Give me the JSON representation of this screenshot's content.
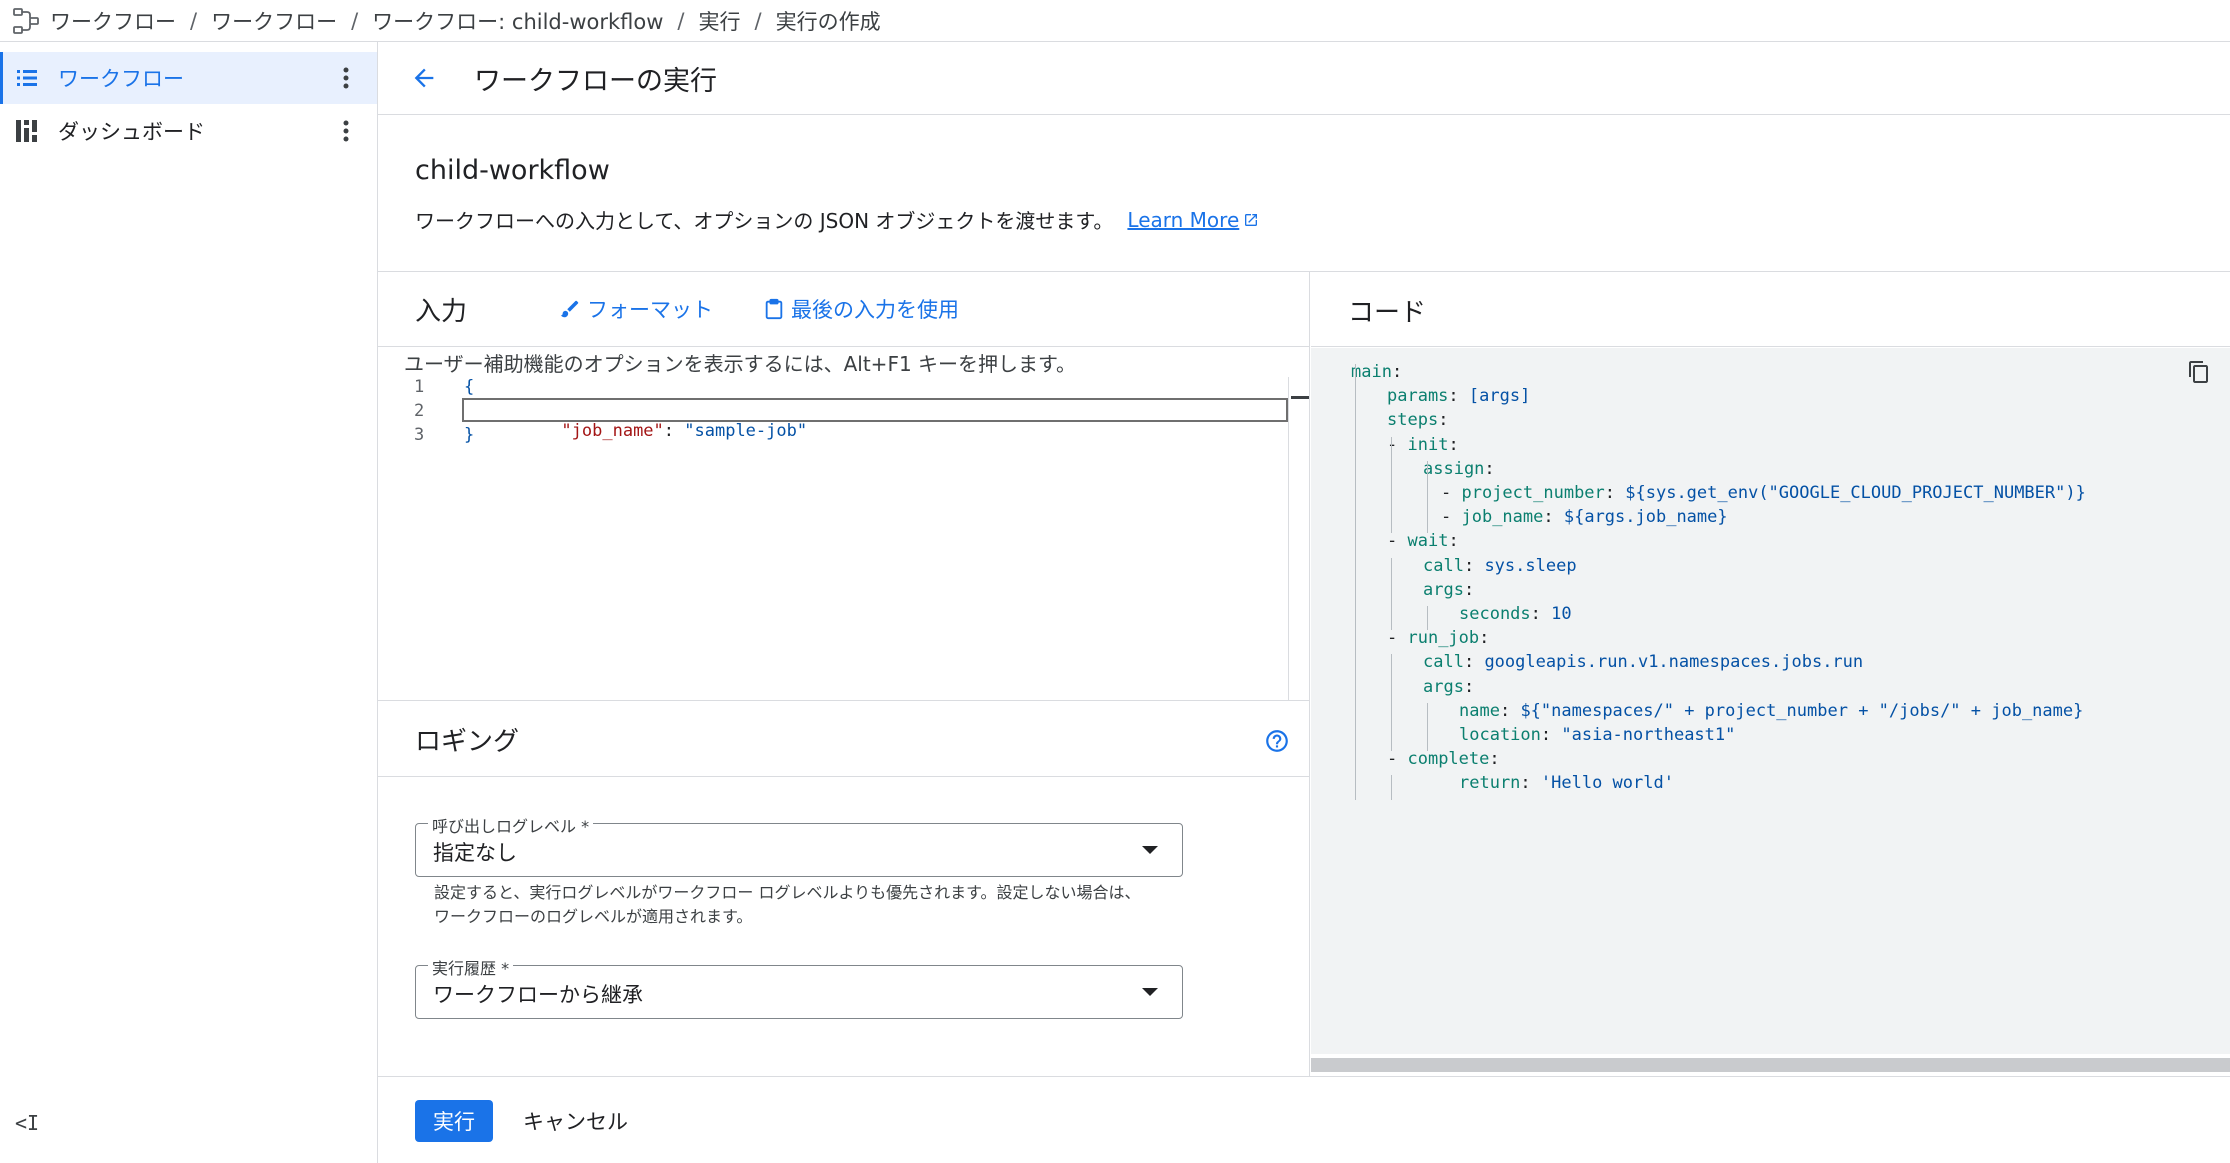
{
  "breadcrumb": {
    "items": [
      "ワークフロー",
      "ワークフロー",
      "ワークフロー: child-workflow",
      "実行",
      "実行の作成"
    ],
    "separator": "/"
  },
  "sidebar": {
    "items": [
      {
        "label": "ワークフロー",
        "icon": "list-icon",
        "active": true
      },
      {
        "label": "ダッシュボード",
        "icon": "dashboard-icon",
        "active": false
      }
    ],
    "collapse_label": "<I"
  },
  "header": {
    "title": "ワークフローの実行"
  },
  "intro": {
    "workflow_name": "child-workflow",
    "description": "ワークフローへの入力として、オプションの JSON オブジェクトを渡せます。",
    "learn_more": "Learn More"
  },
  "input_panel": {
    "title": "入力",
    "format_button": "フォーマット",
    "last_input_button": "最後の入力を使用",
    "a11y_hint": "ユーザー補助機能のオプションを表示するには、Alt+F1 キーを押します。",
    "line_numbers": [
      "1",
      "2",
      "3"
    ],
    "lines": {
      "open": "{",
      "key": "\"job_name\"",
      "colon": ": ",
      "value": "\"sample-job\"",
      "close": "}"
    }
  },
  "logging": {
    "title": "ロギング",
    "call_log_level": {
      "label": "呼び出しログレベル *",
      "value": "指定なし",
      "hint": "設定すると、実行ログレベルがワークフロー ログレベルよりも優先されます。設定しない場合は、ワークフローのログレベルが適用されます。"
    },
    "execution_history": {
      "label": "実行履歴 *",
      "value": "ワークフローから継承"
    }
  },
  "code_panel": {
    "title": "コード",
    "lines": [
      {
        "key": "main",
        "sep": ":",
        "val": ""
      },
      {
        "key": "params",
        "sep": ": ",
        "val": "[args]"
      },
      {
        "key": "steps",
        "sep": ":",
        "val": ""
      },
      {
        "key": "init",
        "sep": ":",
        "val": "",
        "dash": "- "
      },
      {
        "key": "assign",
        "sep": ":",
        "val": ""
      },
      {
        "key": "project_number",
        "sep": ": ",
        "val": "${sys.get_env(\"GOOGLE_CLOUD_PROJECT_NUMBER\")}",
        "dash": "- "
      },
      {
        "key": "job_name",
        "sep": ": ",
        "val": "${args.job_name}",
        "dash": "- "
      },
      {
        "key": "wait",
        "sep": ":",
        "val": "",
        "dash": "- "
      },
      {
        "key": "call",
        "sep": ": ",
        "val": "sys.sleep"
      },
      {
        "key": "args",
        "sep": ":",
        "val": ""
      },
      {
        "key": "seconds",
        "sep": ": ",
        "val": "10"
      },
      {
        "key": "run_job",
        "sep": ":",
        "val": "",
        "dash": "- "
      },
      {
        "key": "call",
        "sep": ": ",
        "val": "googleapis.run.v1.namespaces.jobs.run"
      },
      {
        "key": "args",
        "sep": ":",
        "val": ""
      },
      {
        "key": "name",
        "sep": ": ",
        "val": "${\"namespaces/\" + project_number + \"/jobs/\" + job_name}"
      },
      {
        "key": "location",
        "sep": ": ",
        "val": "\"asia-northeast1\""
      },
      {
        "key": "complete",
        "sep": ":",
        "val": "",
        "dash": "- "
      },
      {
        "key": "return",
        "sep": ": ",
        "val": "'Hello world'"
      }
    ]
  },
  "footer": {
    "run_button": "実行",
    "cancel_button": "キャンセル"
  },
  "colors": {
    "accent": "#1a73e8",
    "active_bg": "#e8f0fe",
    "code_bg": "#f1f3f4",
    "yaml_key": "#0b7f6f",
    "yaml_value": "#0451a5",
    "json_key": "#a31515"
  }
}
